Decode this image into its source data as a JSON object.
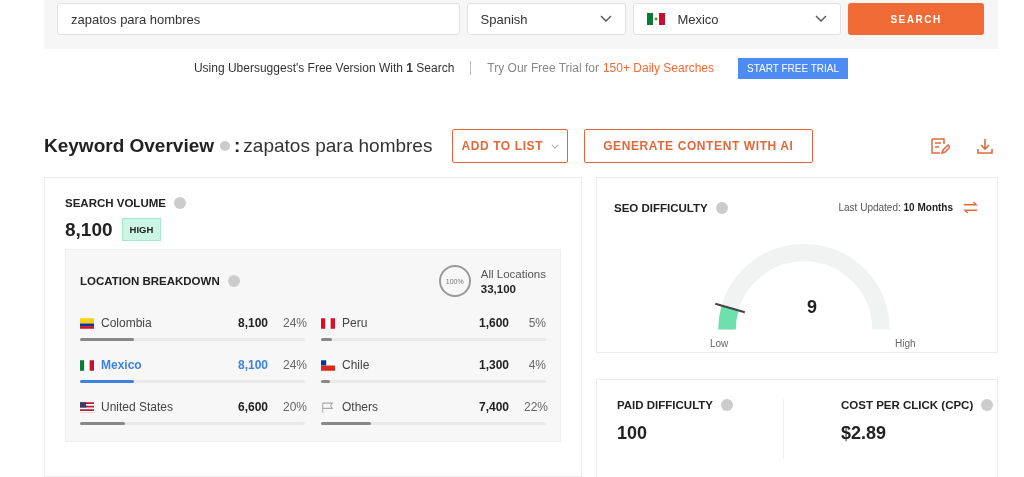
{
  "search": {
    "keyword": "zapatos para hombres",
    "language": "Spanish",
    "country": {
      "name": "Mexico",
      "kind": "mexico"
    },
    "button": "SEARCH"
  },
  "banner": {
    "text": "Using Ubersuggest's Free Version With **1** Search",
    "trial_text": "Try Our Free Trial for",
    "trial_highlight": "150+ Daily Searches",
    "button": "START FREE TRIAL"
  },
  "overview": {
    "title": "Keyword Overview",
    "separator": ":",
    "keyword": "zapatos para hombres",
    "add_button": "ADD TO LIST",
    "generate_button": "GENERATE CONTENT WITH AI"
  },
  "search_volume": {
    "label": "SEARCH VOLUME",
    "value": "8,100",
    "badge": "HIGH"
  },
  "location_breakdown": {
    "label": "LOCATION BREAKDOWN",
    "ring": "100%",
    "all_label": "All Locations",
    "all_value": "33,100",
    "locations": [
      {
        "kind": "colombia",
        "name": "Colombia",
        "volume": "8,100",
        "percent": "24%",
        "level": 0.24,
        "selected": false
      },
      {
        "kind": "peru",
        "name": "Peru",
        "volume": "1,600",
        "percent": "5%",
        "level": 0.05,
        "selected": false
      },
      {
        "kind": "mexico",
        "name": "Mexico",
        "volume": "8,100",
        "percent": "24%",
        "level": 0.24,
        "selected": true
      },
      {
        "kind": "chile",
        "name": "Chile",
        "volume": "1,300",
        "percent": "4%",
        "level": 0.04,
        "selected": false
      },
      {
        "kind": "us",
        "name": "United States",
        "volume": "6,600",
        "percent": "20%",
        "level": 0.2,
        "selected": false
      },
      {
        "kind": "other",
        "name": "Others",
        "volume": "7,400",
        "percent": "22%",
        "level": 0.22,
        "selected": false
      }
    ]
  },
  "seo_difficulty": {
    "label": "SEO DIFFICULTY",
    "updated_label": "Last Updated:",
    "updated_value": "10 Months",
    "value": "9",
    "low": "Low",
    "high": "High"
  },
  "metrics": [
    {
      "label": "PAID DIFFICULTY",
      "value": "100"
    },
    {
      "label": "COST PER CLICK (CPC)",
      "value": "$2.89"
    }
  ]
}
